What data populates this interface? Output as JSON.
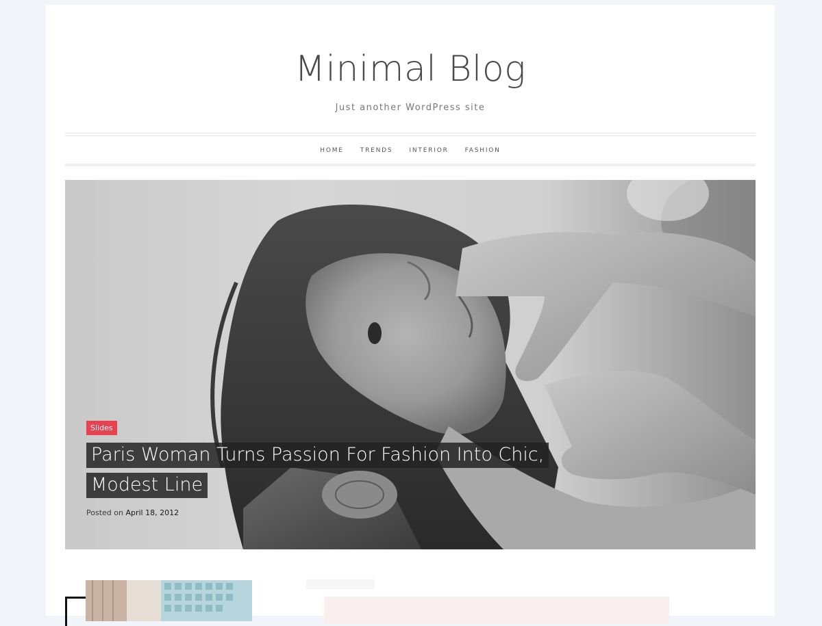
{
  "site": {
    "title": "Minimal Blog",
    "tagline": "Just another WordPress site"
  },
  "nav": {
    "items": [
      {
        "label": "HOME"
      },
      {
        "label": "TRENDS"
      },
      {
        "label": "INTERIOR"
      },
      {
        "label": "FASHION"
      }
    ]
  },
  "featured_post": {
    "category": "Slides",
    "title": "Paris Woman Turns Passion For Fashion Into Chic, Modest Line",
    "posted_prefix": "Posted on",
    "date": "April 18, 2012",
    "image": "black-and-white-photo-woman-hands-on-face"
  },
  "colors": {
    "page_bg": "#f1f5f9",
    "accent_badge": "#e8414f",
    "text_main": "#4a4a4a"
  }
}
